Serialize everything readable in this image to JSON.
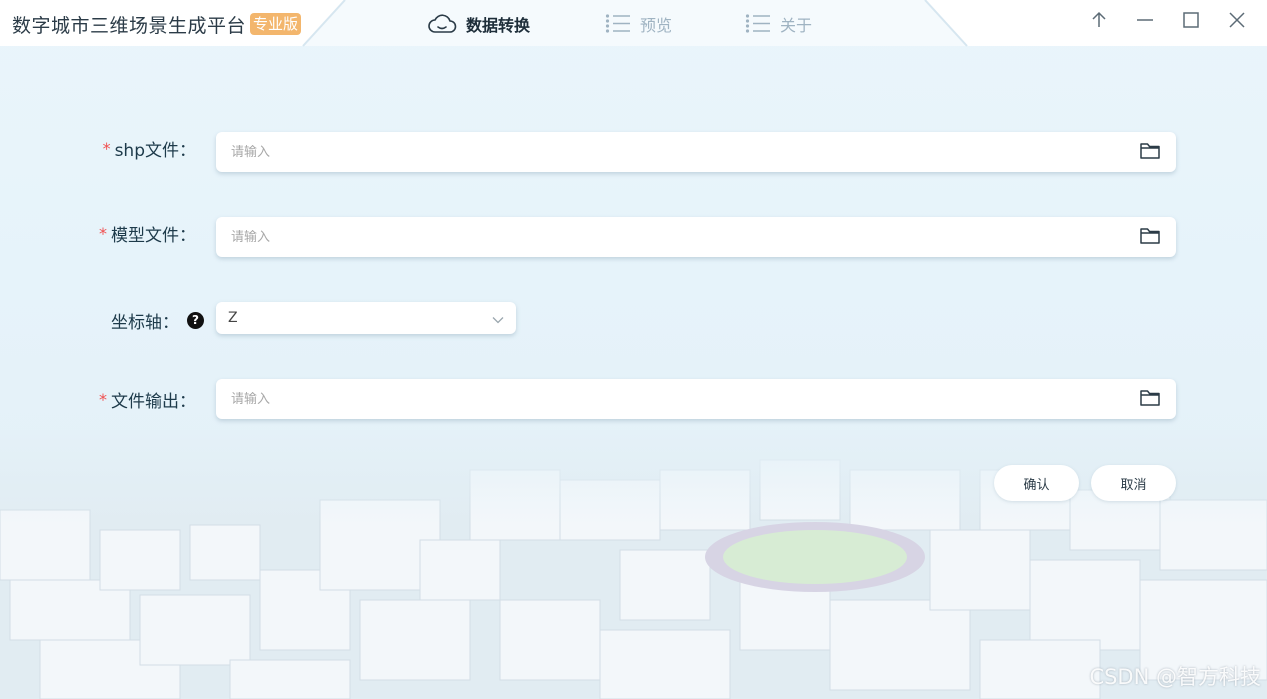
{
  "app": {
    "title": "数字城市三维场景生成平台",
    "badge": "专业版"
  },
  "nav": {
    "items": [
      {
        "label": "数据转换",
        "icon": "cloud-icon",
        "active": true
      },
      {
        "label": "预览",
        "icon": "list-icon",
        "active": false
      },
      {
        "label": "关于",
        "icon": "list-icon",
        "active": false
      }
    ]
  },
  "window_controls": [
    "pin-up-icon",
    "minimize-icon",
    "maximize-icon",
    "close-icon"
  ],
  "form": {
    "shp_file": {
      "label": "shp文件：",
      "required": true,
      "placeholder": "请输入",
      "value": ""
    },
    "model_file": {
      "label": "模型文件：",
      "required": true,
      "placeholder": "请输入",
      "value": ""
    },
    "axis": {
      "label": "坐标轴：",
      "required": false,
      "help": "?",
      "value": "Z"
    },
    "output_file": {
      "label": "文件输出：",
      "required": true,
      "placeholder": "请输入",
      "value": ""
    },
    "required_mark": "*"
  },
  "buttons": {
    "confirm": "确认",
    "cancel": "取消"
  },
  "watermark": "CSDN @智方科技",
  "colors": {
    "accent_badge": "#f3b66d",
    "required": "#f04f4f",
    "nav_active": "#1e2e3a",
    "nav_inactive": "#9fb3c2"
  }
}
